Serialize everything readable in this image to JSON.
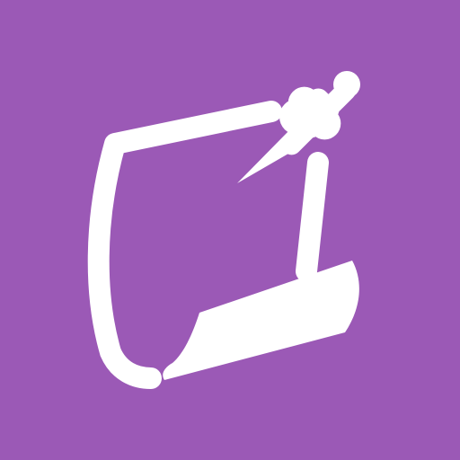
{
  "app_icon": {
    "icon_name": "sticky-note-pin-icon",
    "background_color": "#9b59b6",
    "foreground_color": "#ffffff"
  }
}
